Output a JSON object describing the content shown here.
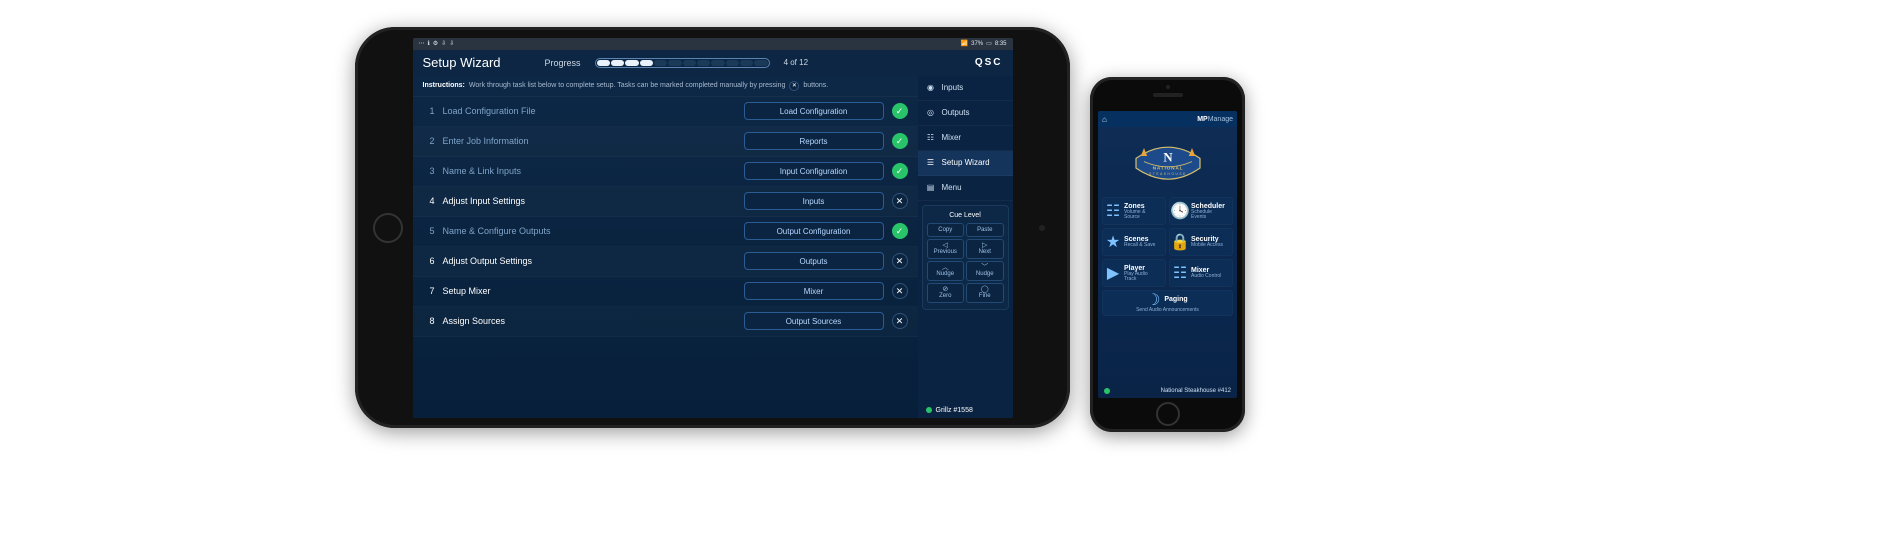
{
  "tablet": {
    "status": {
      "battery": "37%",
      "time": "8:35"
    },
    "header": {
      "title": "Setup Wizard",
      "progress_label": "Progress",
      "progress_text": "4 of 12",
      "brand": "QSC",
      "segments_total": 12,
      "segments_filled": 4
    },
    "instructions": {
      "label": "Instructions:",
      "text_pre": "Work through task list below to complete setup.  Tasks can be marked completed manually by pressing",
      "text_post": "buttons."
    },
    "tasks": [
      {
        "num": "1",
        "name": "Load Configuration File",
        "button": "Load Configuration",
        "done": true
      },
      {
        "num": "2",
        "name": "Enter Job Information",
        "button": "Reports",
        "done": true
      },
      {
        "num": "3",
        "name": "Name & Link Inputs",
        "button": "Input Configuration",
        "done": true
      },
      {
        "num": "4",
        "name": "Adjust Input Settings",
        "button": "Inputs",
        "done": false,
        "active": true
      },
      {
        "num": "5",
        "name": "Name & Configure Outputs",
        "button": "Output Configuration",
        "done": true
      },
      {
        "num": "6",
        "name": "Adjust Output Settings",
        "button": "Outputs",
        "done": false
      },
      {
        "num": "7",
        "name": "Setup Mixer",
        "button": "Mixer",
        "done": false
      },
      {
        "num": "8",
        "name": "Assign Sources",
        "button": "Output Sources",
        "done": false
      }
    ],
    "side_nav": [
      {
        "label": "Inputs",
        "icon": "input-icon"
      },
      {
        "label": "Outputs",
        "icon": "output-icon"
      },
      {
        "label": "Mixer",
        "icon": "mixer-icon"
      },
      {
        "label": "Setup Wizard",
        "icon": "wizard-icon",
        "active": true
      },
      {
        "label": "Menu",
        "icon": "menu-icon"
      }
    ],
    "cue": {
      "title": "Cue Level",
      "copy": "Copy",
      "paste": "Paste",
      "previous": "Previous",
      "next": "Next",
      "nudge_left": "Nudge",
      "nudge_right": "Nudge",
      "zero": "Zero",
      "fine": "Fine"
    },
    "footer_status": "Grillz #1558"
  },
  "phone": {
    "header": {
      "brand_a": "MP",
      "brand_b": "Manage"
    },
    "venue_logo": {
      "top": "NATIONAL",
      "bottom": "STEAKHOUSE"
    },
    "tiles": [
      {
        "icon": "zones-icon",
        "label": "Zones",
        "sub": "Volume & Source"
      },
      {
        "icon": "scheduler-icon",
        "label": "Scheduler",
        "sub": "Schedule Events"
      },
      {
        "icon": "scenes-icon",
        "label": "Scenes",
        "sub": "Recall & Save"
      },
      {
        "icon": "security-icon",
        "label": "Security",
        "sub": "Mobile Access"
      },
      {
        "icon": "player-icon",
        "label": "Player",
        "sub": "Play Audio Track"
      },
      {
        "icon": "mixer-icon",
        "label": "Mixer",
        "sub": "Audio Control"
      }
    ],
    "paging": {
      "label": "Paging",
      "sub": "Send Audio Announcements"
    },
    "footer_status": "National Steakhouse #412"
  }
}
